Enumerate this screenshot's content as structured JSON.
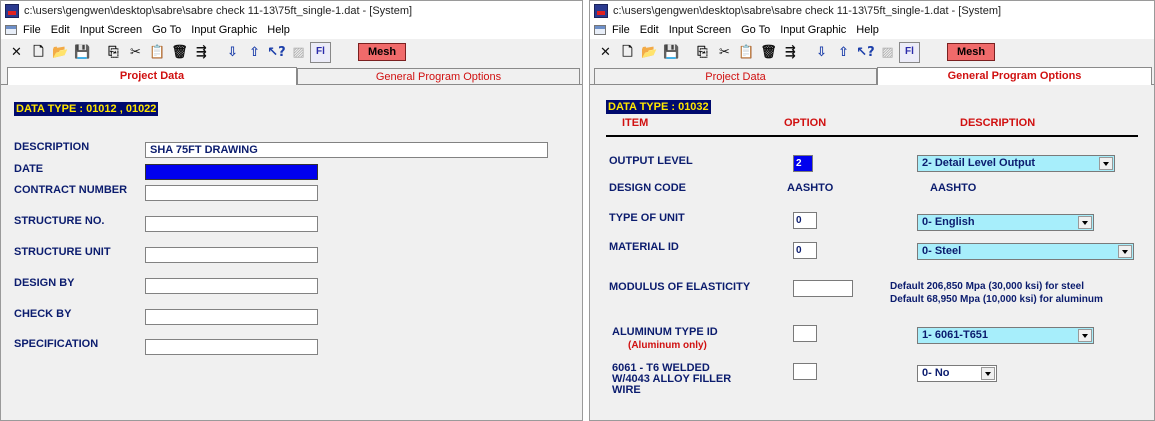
{
  "left_window": {
    "title": "c:\\users\\gengwen\\desktop\\sabre\\sabre check 11-13\\75ft_single-1.dat - [System]",
    "menu": [
      "File",
      "Edit",
      "Input Screen",
      "Go To",
      "Input Graphic",
      "Help"
    ],
    "mesh_label": "Mesh",
    "tabs": [
      "Project Data",
      "General Program Options"
    ],
    "data_type": "DATA TYPE  : 01012 ,  01022",
    "fields": [
      {
        "label": "DESCRIPTION",
        "value": "SHA 75FT DRAWING"
      },
      {
        "label": "DATE",
        "value": ""
      },
      {
        "label": "CONTRACT NUMBER",
        "value": ""
      },
      {
        "label": "STRUCTURE NO.",
        "value": ""
      },
      {
        "label": "STRUCTURE UNIT",
        "value": ""
      },
      {
        "label": "DESIGN BY",
        "value": ""
      },
      {
        "label": "CHECK BY",
        "value": ""
      },
      {
        "label": "SPECIFICATION",
        "value": ""
      }
    ]
  },
  "right_window": {
    "title": "c:\\users\\gengwen\\desktop\\sabre\\sabre check 11-13\\75ft_single-1.dat - [System]",
    "menu": [
      "File",
      "Edit",
      "Input Screen",
      "Go To",
      "Input Graphic",
      "Help"
    ],
    "mesh_label": "Mesh",
    "tabs": [
      "Project Data",
      "General Program Options"
    ],
    "data_type": "DATA TYPE : 01032",
    "headers": {
      "item": "ITEM",
      "option": "OPTION",
      "description": "DESCRIPTION"
    },
    "rows": {
      "output_level": {
        "label": "OUTPUT LEVEL",
        "option": "2",
        "description": "2- Detail Level Output"
      },
      "design_code": {
        "label": "DESIGN CODE",
        "option": "AASHTO",
        "description": "AASHTO"
      },
      "type_of_unit": {
        "label": "TYPE OF UNIT",
        "option": "0",
        "description": "0- English"
      },
      "material_id": {
        "label": "MATERIAL ID",
        "option": "0",
        "description": "0- Steel"
      },
      "modulus": {
        "label": "MODULUS OF ELASTICITY",
        "option": "",
        "note1": "Default 206,850 Mpa (30,000 ksi) for steel",
        "note2": "Default  68,950 Mpa (10,000 ksi) for aluminum"
      },
      "aluminum_type": {
        "label": "ALUMINUM TYPE ID",
        "sublabel": "(Aluminum only)",
        "option": "",
        "description": "1- 6061-T651"
      },
      "welded": {
        "label1": "6061 - T6 WELDED",
        "label2": "W/4043 ALLOY FILLER",
        "label3": "WIRE",
        "option": "",
        "description": "0- No"
      }
    }
  },
  "colors": {
    "data_type_bg": "#000a6e",
    "data_type_text": "#ffe600",
    "combo_bg": "#a7eefb",
    "mesh_bg": "#f06a6a",
    "selected_blue": "#0000ee",
    "label_navy": "#0b1c6e",
    "header_red": "#d01010"
  }
}
